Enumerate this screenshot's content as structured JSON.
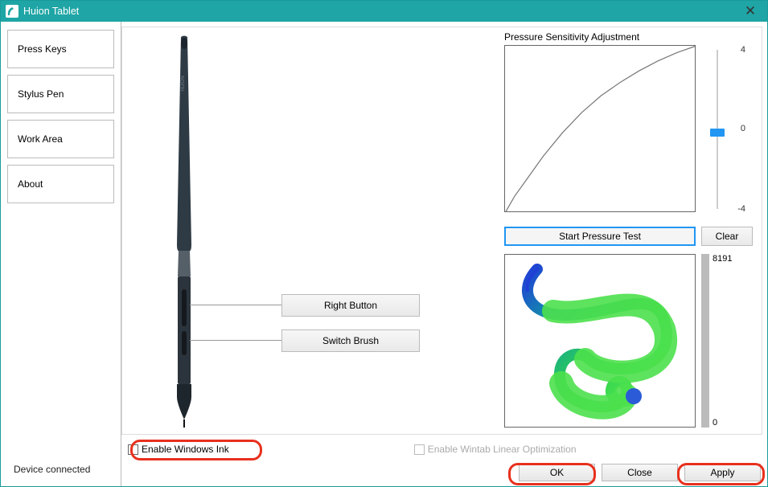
{
  "title": "Huion Tablet",
  "sidebar": {
    "items": [
      {
        "label": "Press Keys"
      },
      {
        "label": "Stylus Pen"
      },
      {
        "label": "Work Area"
      },
      {
        "label": "About"
      }
    ],
    "activeIndex": 1,
    "deviceStatus": "Device connected"
  },
  "pen": {
    "upperBtn": "Right Button",
    "lowerBtn": "Switch Brush"
  },
  "pressure": {
    "label": "Pressure Sensitivity Adjustment",
    "sliderMax": "4",
    "sliderMid": "0",
    "sliderMin": "-4",
    "startTest": "Start Pressure Test",
    "clear": "Clear",
    "barMax": "8191",
    "barMin": "0"
  },
  "footer": {
    "enableInk": "Enable  Windows Ink",
    "enableWintab": "Enable Wintab Linear Optimization",
    "ok": "OK",
    "close": "Close",
    "apply": "Apply"
  },
  "chart_data": {
    "type": "line",
    "title": "Pressure Sensitivity Adjustment",
    "xlabel": "",
    "ylabel": "",
    "xlim": [
      0,
      1
    ],
    "ylim": [
      0,
      1
    ],
    "series": [
      {
        "name": "curve",
        "x": [
          0,
          0.05,
          0.1,
          0.15,
          0.2,
          0.3,
          0.4,
          0.5,
          0.6,
          0.7,
          0.8,
          0.9,
          1.0
        ],
        "values": [
          0,
          0.1,
          0.18,
          0.26,
          0.34,
          0.48,
          0.6,
          0.7,
          0.78,
          0.85,
          0.91,
          0.96,
          1.0
        ]
      }
    ]
  }
}
